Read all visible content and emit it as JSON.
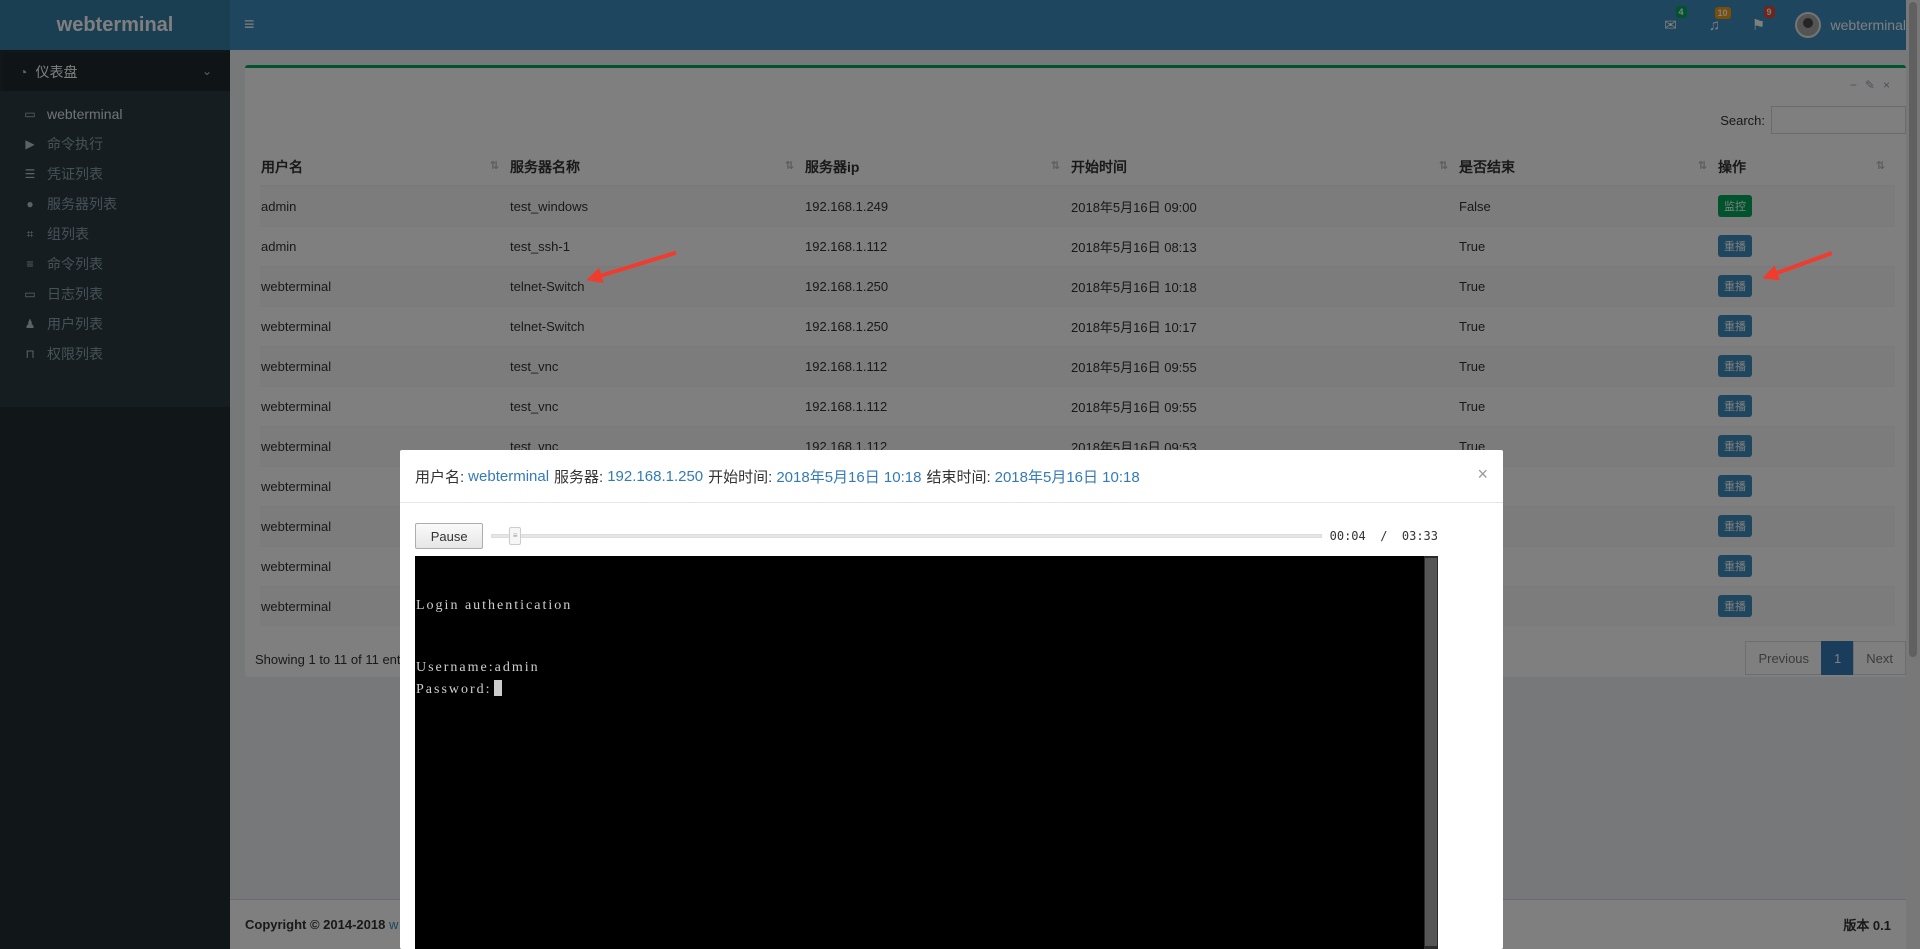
{
  "app": {
    "logo": "webterminal"
  },
  "sidebar": {
    "header": "仪表盘",
    "items": [
      {
        "label": "webterminal",
        "icon": "laptop-icon"
      },
      {
        "label": "命令执行",
        "icon": "play-icon"
      },
      {
        "label": "凭证列表",
        "icon": "list-ol-icon"
      },
      {
        "label": "服务器列表",
        "icon": "circle-icon"
      },
      {
        "label": "组列表",
        "icon": "crop-icon"
      },
      {
        "label": "命令列表",
        "icon": "tasks-icon"
      },
      {
        "label": "日志列表",
        "icon": "desktop-icon"
      },
      {
        "label": "用户列表",
        "icon": "user-icon"
      },
      {
        "label": "权限列表",
        "icon": "lock-icon"
      }
    ]
  },
  "header": {
    "mail_count": "4",
    "bell_count": "10",
    "flag_count": "9",
    "user": "webterminal"
  },
  "box": {
    "search_label": "Search:",
    "columns": [
      "用户名",
      "服务器名称",
      "服务器ip",
      "开始时间",
      "是否结束",
      "操作"
    ],
    "rows": [
      {
        "user": "admin",
        "server": "test_windows",
        "ip": "192.168.1.249",
        "start": "2018年5月16日 09:00",
        "ended": "False",
        "action": "监控"
      },
      {
        "user": "admin",
        "server": "test_ssh-1",
        "ip": "192.168.1.112",
        "start": "2018年5月16日 08:13",
        "ended": "True",
        "action": "重播"
      },
      {
        "user": "webterminal",
        "server": "telnet-Switch",
        "ip": "192.168.1.250",
        "start": "2018年5月16日 10:18",
        "ended": "True",
        "action": "重播"
      },
      {
        "user": "webterminal",
        "server": "telnet-Switch",
        "ip": "192.168.1.250",
        "start": "2018年5月16日 10:17",
        "ended": "True",
        "action": "重播"
      },
      {
        "user": "webterminal",
        "server": "test_vnc",
        "ip": "192.168.1.112",
        "start": "2018年5月16日 09:55",
        "ended": "True",
        "action": "重播"
      },
      {
        "user": "webterminal",
        "server": "test_vnc",
        "ip": "192.168.1.112",
        "start": "2018年5月16日 09:55",
        "ended": "True",
        "action": "重播"
      },
      {
        "user": "webterminal",
        "server": "test_vnc",
        "ip": "192.168.1.112",
        "start": "2018年5月16日 09:53",
        "ended": "True",
        "action": "重播"
      },
      {
        "user": "webterminal",
        "server": "",
        "ip": "",
        "start": "",
        "ended": "",
        "action": "重播"
      },
      {
        "user": "webterminal",
        "server": "",
        "ip": "",
        "start": "",
        "ended": "",
        "action": "重播"
      },
      {
        "user": "webterminal",
        "server": "",
        "ip": "",
        "start": "",
        "ended": "",
        "action": "重播"
      },
      {
        "user": "webterminal",
        "server": "",
        "ip": "",
        "start": "",
        "ended": "",
        "action": "重播"
      }
    ],
    "info": "Showing 1 to 11 of 11 ent",
    "pager": {
      "prev": "Previous",
      "page": "1",
      "next": "Next"
    }
  },
  "footer": {
    "copyright": "Copyright © 2014-2018",
    "link": "w",
    "version": "版本 0.1"
  },
  "modal": {
    "user_label": "用户名:",
    "user": "webterminal",
    "server_label": "服务器:",
    "server": "192.168.1.250",
    "start_label": "开始时间:",
    "start": "2018年5月16日 10:18",
    "end_label": "结束时间:",
    "end": "2018年5月16日 10:18",
    "close": "×",
    "pause": "Pause",
    "time": "00:04  /  03:33",
    "progress": 0.02,
    "terminal": {
      "line1": "Login authentication",
      "line2": "Username:admin",
      "line3": "Password:"
    }
  },
  "colors": {
    "header": "#3c8dbc",
    "sidebar": "#222d32",
    "accent": "#00a65a",
    "arrow": "#f03c2e"
  }
}
